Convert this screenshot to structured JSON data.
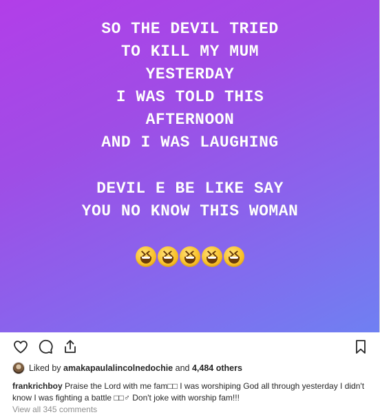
{
  "post": {
    "lines_block1": [
      "SO THE DEVIL TRIED",
      "TO KILL MY MUM",
      "YESTERDAY",
      "I WAS TOLD THIS",
      "AFTERNOON",
      "AND I WAS LAUGHING"
    ],
    "lines_block2": [
      "DEVIL E BE LIKE SAY",
      "YOU NO KNOW THIS WOMAN"
    ],
    "emoji_name": "grinning-squinting-face",
    "emoji_count": 5,
    "gradient_colors": [
      "#b23ee8",
      "#6f80f2"
    ]
  },
  "actions": {
    "like_icon": "heart-icon",
    "comment_icon": "comment-icon",
    "share_icon": "share-icon",
    "save_icon": "bookmark-icon"
  },
  "likes": {
    "prefix": "Liked by",
    "user": "amakapaulalincolnedochie",
    "conjunction": "and",
    "others": "4,484 others"
  },
  "caption": {
    "username": "frankrichboy",
    "text": "Praise the Lord with me fam□□ I was worshiping God all through yesterday I didn't know I was fighting a battle □□♂ Don't joke with worship fam!!!"
  },
  "comments": {
    "view_all": "View all 345 comments"
  }
}
